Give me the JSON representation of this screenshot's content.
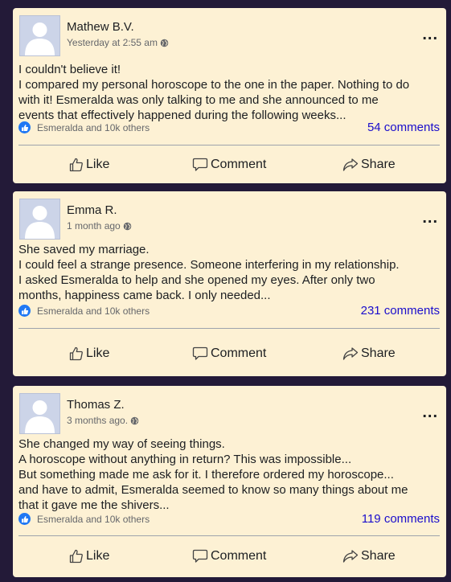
{
  "posts": [
    {
      "author": "Mathew B.V.",
      "time": "Yesterday at 2:55 am",
      "lines": [
        "I couldn't believe it!",
        "I compared my personal horoscope to the one in the paper. Nothing to do",
        "with it! Esmeralda was only talking to me and she announced to me",
        "events that effectively happened during the following weeks..."
      ],
      "reactions": "Esmeralda and 10k others",
      "comments": "54 comments"
    },
    {
      "author": "Emma R.",
      "time": "1 month ago",
      "lines": [
        "She saved my marriage.",
        "I could feel a strange presence. Someone interfering in my relationship.",
        "I asked Esmeralda to help and she opened my eyes. After only two",
        "months, happiness came back. I only needed..."
      ],
      "reactions": "Esmeralda and 10k others",
      "comments": "231 comments"
    },
    {
      "author": "Thomas Z.",
      "time": "3 months ago.",
      "lines": [
        "She changed my way of seeing things.",
        "A horoscope without anything in return? This was impossible...",
        "But something made me ask for it. I therefore ordered my horoscope...",
        "and have to admit, Esmeralda seemed to know so many things about me",
        "that it gave me the shivers..."
      ],
      "reactions": "Esmeralda and 10k others",
      "comments": "119 comments"
    }
  ],
  "actions": {
    "like": "Like",
    "comment": "Comment",
    "share": "Share"
  },
  "more_menu": "...",
  "icons": {
    "avatar": "avatar-placeholder",
    "time": "globe-icon",
    "reaction": "like-badge-icon",
    "like": "thumbs-up-icon",
    "comment": "speech-bubble-icon",
    "share": "share-arrow-icon"
  },
  "colors": {
    "page_background": "#231a38",
    "card_background": "#fdf1d4",
    "link": "#1a0dcc",
    "like_badge": "#2078f4"
  }
}
